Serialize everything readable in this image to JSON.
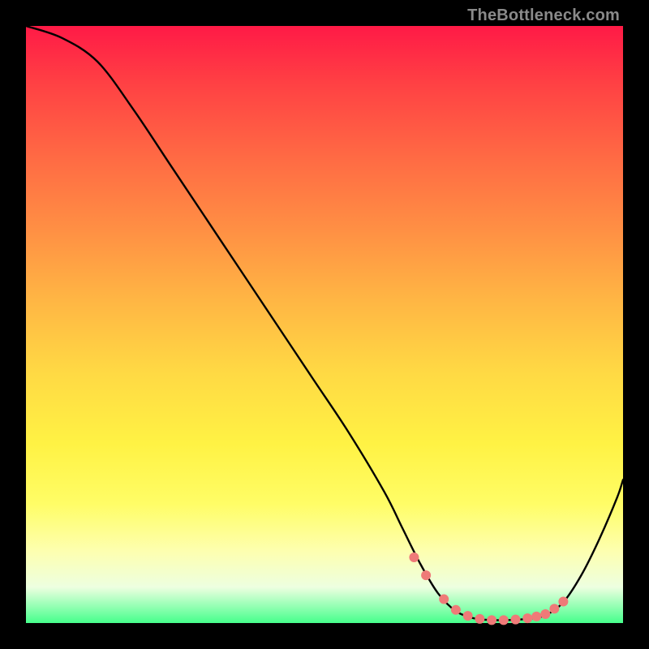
{
  "attribution": "TheBottleneck.com",
  "colors": {
    "curve": "#000000",
    "dots": "#ef7a78"
  },
  "chart_data": {
    "type": "line",
    "title": "",
    "xlabel": "",
    "ylabel": "",
    "xlim": [
      0,
      100
    ],
    "ylim": [
      0,
      100
    ],
    "grid": false,
    "series": [
      {
        "name": "bottleneck-curve",
        "x": [
          0,
          6,
          12,
          18,
          24,
          30,
          36,
          42,
          48,
          54,
          60,
          63,
          66,
          69,
          72,
          75,
          78,
          81,
          84,
          87,
          90,
          93,
          96,
          99,
          100
        ],
        "y": [
          100,
          98,
          94,
          86,
          77,
          68,
          59,
          50,
          41,
          32,
          22,
          16,
          10,
          5,
          2,
          0.8,
          0.5,
          0.5,
          0.7,
          1.3,
          3.5,
          8,
          14,
          21,
          24
        ]
      }
    ],
    "highlight_points": {
      "name": "sweet-spot-dots",
      "x": [
        65,
        67,
        70,
        72,
        74,
        76,
        78,
        80,
        82,
        84,
        85.5,
        87,
        88.5,
        90
      ],
      "y": [
        11,
        8,
        4,
        2.2,
        1.2,
        0.7,
        0.5,
        0.5,
        0.6,
        0.8,
        1.1,
        1.5,
        2.4,
        3.6
      ]
    }
  }
}
